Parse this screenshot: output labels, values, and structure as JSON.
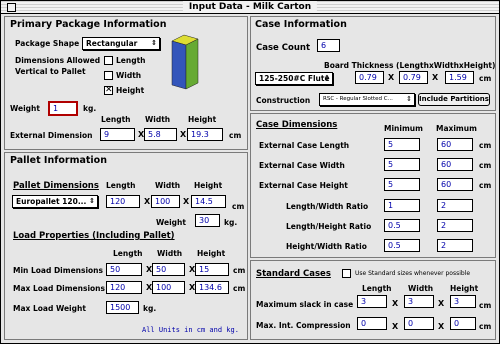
{
  "window": {
    "title": "Input Data - Milk Carton"
  },
  "primary": {
    "heading": "Primary Package Information",
    "shape_label": "Package Shape",
    "shape_value": "Rectangular",
    "dims_allowed_label_1": "Dimensions Allowed",
    "dims_allowed_label_2": "Vertical to Pallet",
    "length_label": "Length",
    "width_label": "Width",
    "height_label": "Height",
    "length_checked": false,
    "width_checked": false,
    "height_checked": true,
    "weight_label": "Weight",
    "weight_value": "1",
    "weight_unit": "kg.",
    "col_length": "Length",
    "col_width": "Width",
    "col_height": "Height",
    "ext_dim_label": "External Dimension",
    "ext_length": "9",
    "ext_width": "5.8",
    "ext_height": "19.3",
    "ext_unit": "cm",
    "x": "X"
  },
  "pallet": {
    "heading": "Pallet Information",
    "dims_heading": "Pallet Dimensions",
    "col_length": "Length",
    "col_width": "Width",
    "col_height": "Height",
    "pallet_type": "Europallet 120...",
    "length": "120",
    "width": "100",
    "height": "14.5",
    "unit_cm": "cm",
    "weight_label": "Weight",
    "weight": "30",
    "unit_kg": "kg.",
    "load_heading": "Load Properties (Including Pallet)",
    "min_label": "Min Load Dimensions",
    "min_length": "50",
    "min_width": "50",
    "min_height": "15",
    "max_label": "Max Load Dimensions",
    "max_length": "120",
    "max_width": "100",
    "max_height": "134.6",
    "max_weight_label": "Max Load Weight",
    "max_weight": "1500",
    "x": "X",
    "note": "All Units in cm and kg."
  },
  "case": {
    "heading": "Case Information",
    "count_label": "Case Count",
    "count": "6",
    "board_label": "Board Thickness (LengthxWidthxHeight)",
    "flute": "125-250#C Flute",
    "board_length": "0.79",
    "board_width": "0.79",
    "board_height": "1.59",
    "unit_cm": "cm",
    "construction_label": "Construction",
    "construction_value": "RSC - Regular Slotted C...",
    "include_partitions": "Include Partitions",
    "x": "X"
  },
  "case_dims": {
    "heading": "Case Dimensions",
    "col_min": "Minimum",
    "col_max": "Maximum",
    "unit_cm": "cm",
    "rows": [
      {
        "label": "External Case Length",
        "min": "5",
        "max": "60",
        "unit": "cm"
      },
      {
        "label": "External Case Width",
        "min": "5",
        "max": "60",
        "unit": "cm"
      },
      {
        "label": "External Case Height",
        "min": "5",
        "max": "60",
        "unit": "cm"
      },
      {
        "label": "Length/Width Ratio",
        "min": "1",
        "max": "2",
        "unit": ""
      },
      {
        "label": "Length/Height Ratio",
        "min": "0.5",
        "max": "2",
        "unit": ""
      },
      {
        "label": "Height/Width Ratio",
        "min": "0.5",
        "max": "2",
        "unit": ""
      }
    ]
  },
  "standard": {
    "heading": "Standard Cases",
    "use_std_label": "Use Standard sizes whenever possible",
    "use_std_checked": false,
    "col_length": "Length",
    "col_width": "Width",
    "col_height": "Height",
    "slack_label": "Maximum slack in case",
    "slack_length": "3",
    "slack_width": "3",
    "slack_height": "3",
    "unit_cm": "cm",
    "comp_label": "Max. Int. Compression",
    "comp_length": "0",
    "comp_width": "0",
    "comp_height": "0",
    "x": "X"
  },
  "colors": {
    "field_text": "#0000aa",
    "weight_border": "#b00000",
    "box_front": "#3355bb",
    "box_side": "#66aa33",
    "box_top": "#dddd33"
  }
}
